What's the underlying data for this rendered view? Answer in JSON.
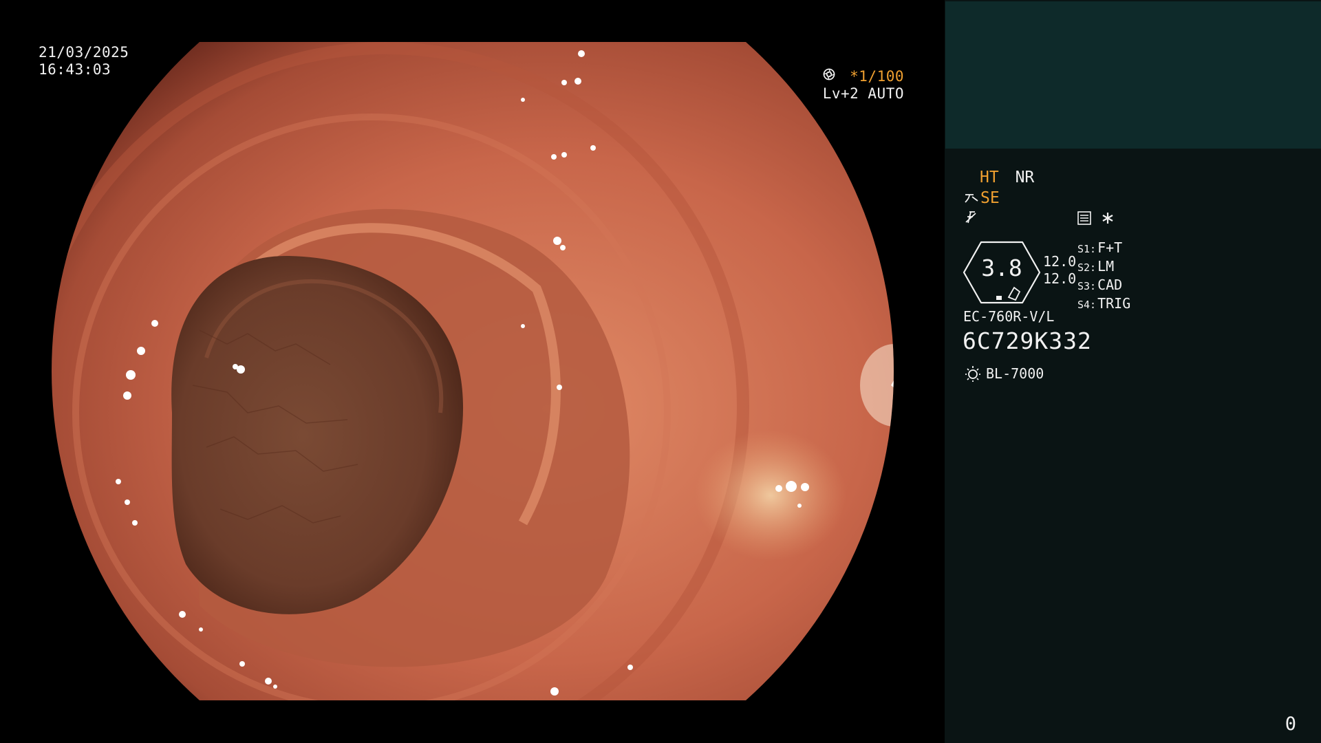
{
  "overlay": {
    "date": "21/03/2025",
    "time": "16:43:03",
    "shutter": "*1/100",
    "level": "Lv+2 AUTO"
  },
  "panel": {
    "mode_ht": "HT",
    "mode_nr": "NR",
    "se": "SE",
    "gauge_value": "3.8",
    "gauge_side_top": "12.0",
    "gauge_side_bottom": "12.0",
    "settings": [
      {
        "key": "S1:",
        "value": "F+T"
      },
      {
        "key": "S2:",
        "value": "LM"
      },
      {
        "key": "S3:",
        "value": "CAD"
      },
      {
        "key": "S4:",
        "value": "TRIG"
      }
    ],
    "scope_model": "EC-760R-V/L",
    "scope_serial": "6C729K332",
    "light_source": "BL-7000",
    "page_number": "0"
  },
  "colors": {
    "accent_orange": "#f0a030",
    "panel_bg": "#0a1414",
    "thumb_bg": "#0e2a2a",
    "mucosa": "#c8664a"
  },
  "icons": [
    "shutter-icon",
    "auto-iris-icon",
    "se-scope-icon",
    "f-icon",
    "memo-icon",
    "asterisk-icon",
    "light-sun-icon"
  ]
}
